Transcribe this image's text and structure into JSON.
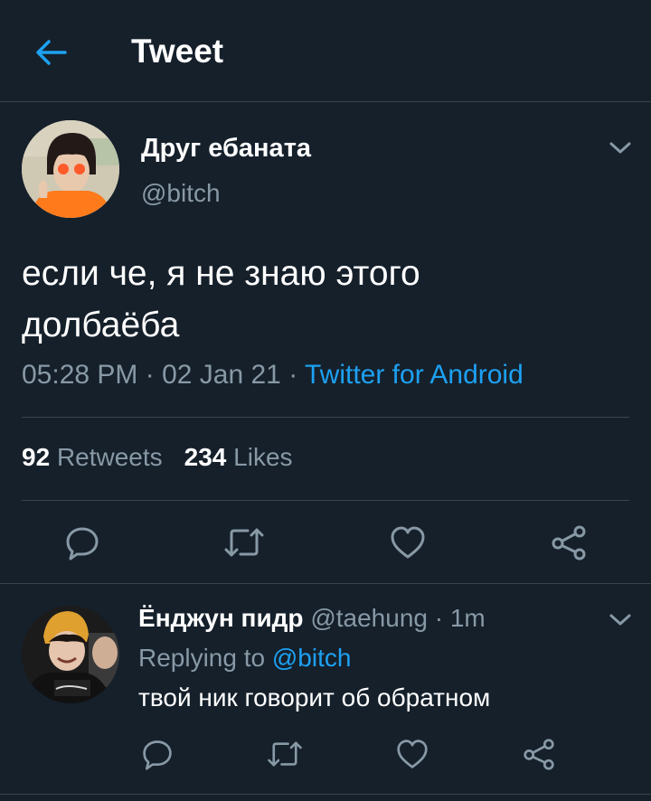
{
  "header": {
    "back_icon": "arrow-left-icon",
    "title": "Tweet"
  },
  "tweet": {
    "author_name": "Друг ебаната",
    "author_handle": "@bitch",
    "text_line1": "если че, я не знаю этого",
    "text_line2": "долбаёба",
    "time": "05:28 PM",
    "sep1": " · ",
    "date": "02 Jan 21",
    "sep2": " · ",
    "source": "Twitter for Android",
    "retweets_count": "92",
    "retweets_label": "Retweets",
    "likes_count": "234",
    "likes_label": "Likes"
  },
  "reply": {
    "author_name": "Ёнджун пидр",
    "author_handle": "@taehung",
    "time": "· 1m",
    "replying_label": "Replying to",
    "replying_to": "@bitch",
    "text": "твой ник говорит об обратном"
  },
  "colors": {
    "background": "#15202b",
    "divider": "#38444d",
    "secondary_text": "#8899a6",
    "accent": "#1da1f2"
  },
  "icons": [
    "arrow-left-icon",
    "chevron-down-icon",
    "reply-icon",
    "retweet-icon",
    "heart-icon",
    "share-icon"
  ]
}
